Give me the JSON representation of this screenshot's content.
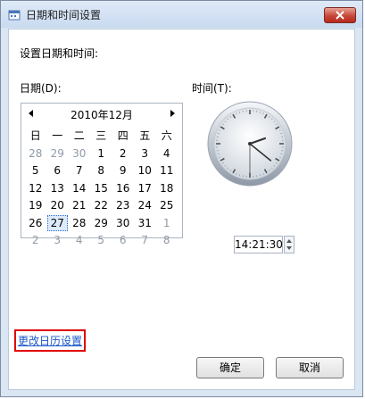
{
  "window": {
    "title": "日期和时间设置",
    "close_label": "✕"
  },
  "dialog": {
    "heading": "设置日期和时间:",
    "date_label": "日期(D):",
    "time_label": "时间(T):",
    "change_calendar_link": "更改日历设置",
    "ok_label": "确定",
    "cancel_label": "取消"
  },
  "calendar": {
    "month_title": "2010年12月",
    "weekdays": [
      "日",
      "一",
      "二",
      "三",
      "四",
      "五",
      "六"
    ],
    "weeks": [
      [
        "28",
        "29",
        "30",
        "1",
        "2",
        "3",
        "4"
      ],
      [
        "5",
        "6",
        "7",
        "8",
        "9",
        "10",
        "11"
      ],
      [
        "12",
        "13",
        "14",
        "15",
        "16",
        "17",
        "18"
      ],
      [
        "19",
        "20",
        "21",
        "22",
        "23",
        "24",
        "25"
      ],
      [
        "26",
        "27",
        "28",
        "29",
        "30",
        "31",
        "1"
      ],
      [
        "2",
        "3",
        "4",
        "5",
        "6",
        "7",
        "8"
      ]
    ],
    "selected_day": "27"
  },
  "time": {
    "value": "14:21:30"
  }
}
